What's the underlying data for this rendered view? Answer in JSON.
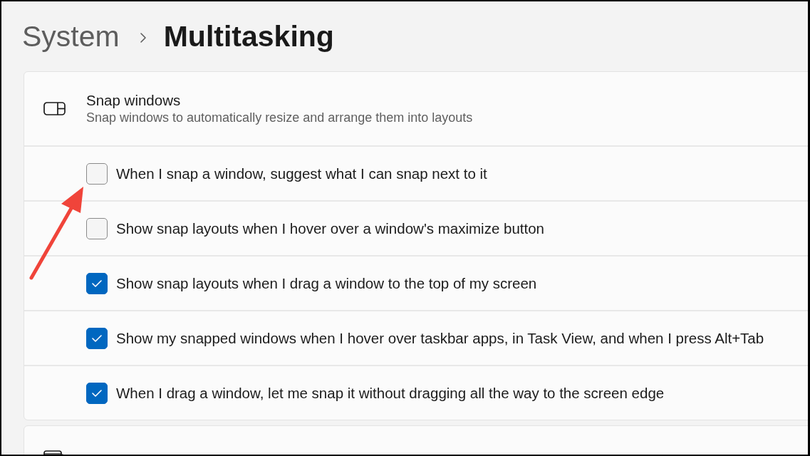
{
  "breadcrumb": [
    {
      "label": "System",
      "current": false
    },
    {
      "label": "Multitasking",
      "current": true
    }
  ],
  "sections": [
    {
      "kind": "options",
      "title": "Snap windows",
      "description": "Snap windows to automatically resize and arrange them into layouts",
      "options": [
        {
          "label": "When I snap a window, suggest what I can snap next to it",
          "checked": false,
          "annotated": true
        },
        {
          "label": "Show snap layouts when I hover over a window's maximize button",
          "checked": false,
          "annotated": false
        },
        {
          "label": "Show snap layouts when I drag a window to the top of my screen",
          "checked": true,
          "annotated": false
        },
        {
          "label": "Show my snapped windows when I hover over taskbar apps, in Task View, and when I press Alt+Tab",
          "checked": true,
          "annotated": false
        },
        {
          "label": "When I drag a window, let me snap it without dragging all the way to the screen edge",
          "checked": true,
          "annotated": false
        }
      ]
    },
    {
      "kind": "cut_off"
    }
  ]
}
